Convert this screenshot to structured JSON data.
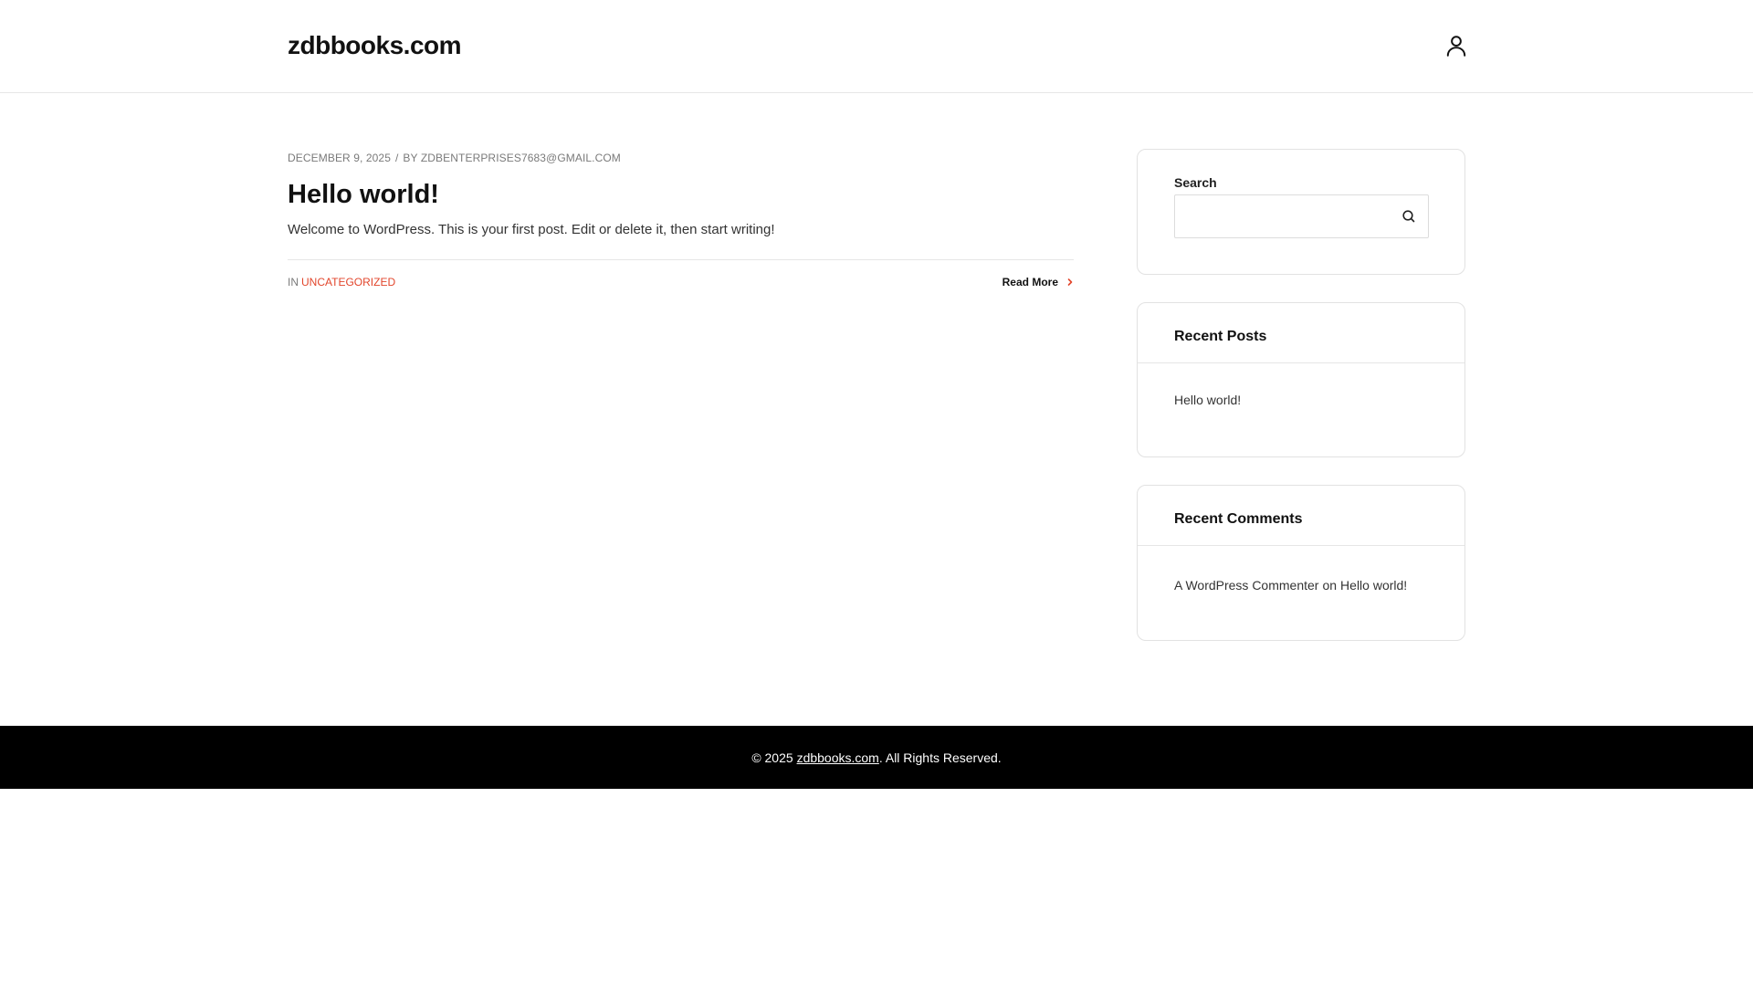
{
  "header": {
    "site_title": "zdbbooks.com",
    "account_icon": "user-icon"
  },
  "post": {
    "date": "DECEMBER 9, 2025",
    "separator": "/",
    "by_label": "BY",
    "author": "ZDBENTERPRISES7683@GMAIL.COM",
    "title": "Hello world!",
    "excerpt": "Welcome to WordPress. This is your first post. Edit or delete it, then start writing!",
    "in_label": "IN",
    "category": "UNCATEGORIZED",
    "read_more": "Read More",
    "read_more_icon": "chevron-right-icon"
  },
  "sidebar": {
    "search": {
      "label": "Search",
      "placeholder": "",
      "value": "",
      "button_icon": "search-icon"
    },
    "recent_posts": {
      "title": "Recent Posts",
      "items": [
        "Hello world!"
      ]
    },
    "recent_comments": {
      "title": "Recent Comments",
      "items": [
        {
          "author": "A WordPress Commenter",
          "on": "on",
          "post": "Hello world!"
        }
      ]
    }
  },
  "footer": {
    "prefix": "© 2025",
    "site_link": "zdbbooks.com",
    "suffix": ". All Rights Reserved."
  },
  "colors": {
    "accent": "#e2462c",
    "footer_bg": "#000000",
    "text": "#333333",
    "heading": "#111111"
  }
}
